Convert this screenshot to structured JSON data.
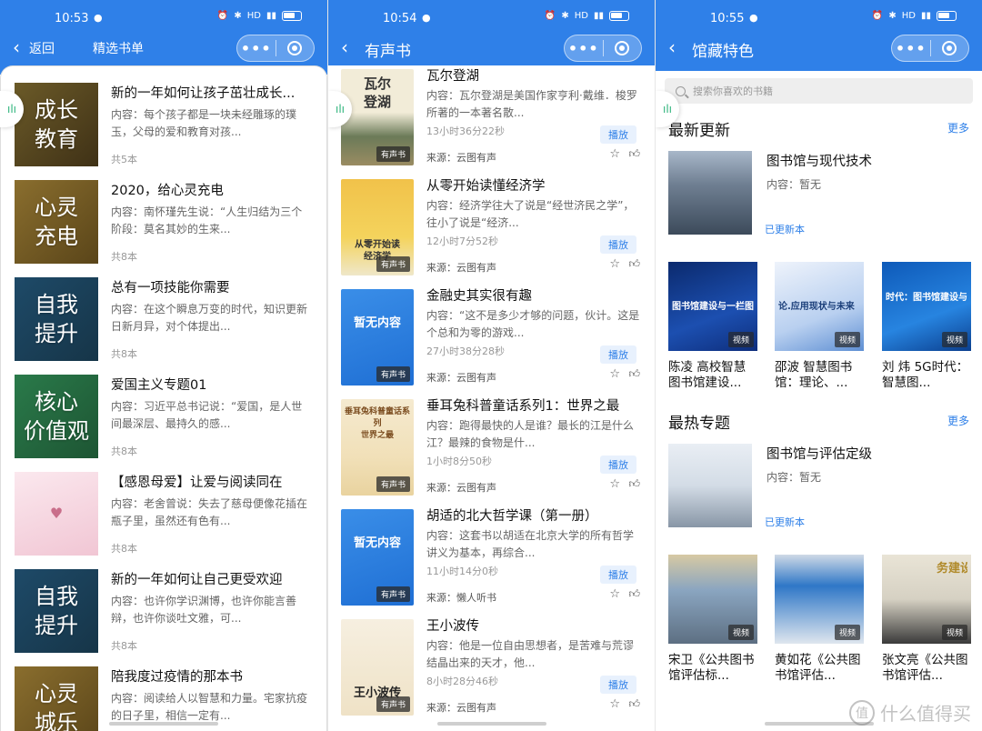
{
  "screen1": {
    "status": {
      "time": "10:53"
    },
    "nav": {
      "back": "返回",
      "title": "精选书单"
    },
    "items": [
      {
        "cover": "成长\n教育",
        "title": "新的一年如何让孩子茁壮成长...",
        "desc": "内容：每个孩子都是一块未经雕琢的璞玉，父母的爱和教育对孩...",
        "count": "共5本"
      },
      {
        "cover": "心灵\n充电",
        "title": "2020，给心灵充电",
        "desc": "内容：南怀瑾先生说：“人生归结为三个阶段：莫名其妙的生来...",
        "count": "共8本"
      },
      {
        "cover": "自我\n提升",
        "title": "总有一项技能你需要",
        "desc": "内容：在这个瞬息万变的时代，知识更新日新月异，对个体提出...",
        "count": "共8本"
      },
      {
        "cover": "核心\n价值观",
        "title": "爱国主义专题01",
        "desc": "内容：习近平总书记说：“爱国，是人世间最深层、最持久的感...",
        "count": "共8本"
      },
      {
        "cover": "",
        "title": "【感恩母爱】让爱与阅读同在",
        "desc": "内容：老舍曾说：失去了慈母便像花插在瓶子里，虽然还有色有...",
        "count": "共8本"
      },
      {
        "cover": "自我\n提升",
        "title": "新的一年如何让自己更受欢迎",
        "desc": "内容：也许你学识渊博，也许你能言善辩，也许你谈吐文雅，可...",
        "count": "共8本"
      },
      {
        "cover": "心灵\n城乐",
        "title": "陪我度过疫情的那本书",
        "desc": "内容：阅读给人以智慧和力量。宅家抗疫的日子里，相信一定有...",
        "count": ""
      }
    ]
  },
  "screen2": {
    "status": {
      "time": "10:54"
    },
    "nav": {
      "title": "有声书"
    },
    "play_label": "播放",
    "badge": "有声书",
    "items": [
      {
        "cover_text": "瓦尔\n登湖",
        "title": "瓦尔登湖",
        "desc": "内容：瓦尔登湖是美国作家亨利·戴维．梭罗所著的一本著名散...",
        "dur": "13小时36分22秒",
        "source": "来源：云图有声"
      },
      {
        "cover_text": "从零开始读\n经济学",
        "title": "从零开始读懂经济学",
        "desc": "内容：经济学往大了说是“经世济民之学”，往小了说是“经济...",
        "dur": "12小时7分52秒",
        "source": "来源：云图有声"
      },
      {
        "cover_text": "暂无内容",
        "title": "金融史其实很有趣",
        "desc": "内容：“这不是多少才够的问题，伙计。这是个总和为零的游戏...",
        "dur": "27小时38分28秒",
        "source": "来源：云图有声"
      },
      {
        "cover_text": "垂耳兔科普童话系列\n世界之最",
        "title": "垂耳兔科普童话系列1：世界之最",
        "desc": "内容：跑得最快的人是谁？最长的江是什么江？最辣的食物是什...",
        "dur": "1小时8分50秒",
        "source": "来源：云图有声"
      },
      {
        "cover_text": "暂无内容",
        "title": "胡适的北大哲学课（第一册）",
        "desc": "内容：这套书以胡适在北京大学的所有哲学讲义为基本，再综合...",
        "dur": "11小时14分0秒",
        "source": "来源：懒人听书"
      },
      {
        "cover_text": "王小波传",
        "title": "王小波传",
        "desc": "内容：他是一位自由思想者，是苦难与荒谬结晶出来的天才，他...",
        "dur": "8小时28分46秒",
        "source": "来源：云图有声"
      }
    ]
  },
  "screen3": {
    "status": {
      "time": "10:55"
    },
    "nav": {
      "title": "馆藏特色"
    },
    "search_placeholder": "搜索你喜欢的书籍",
    "sections": [
      {
        "title": "最新更新",
        "more": "更多",
        "featured": {
          "title": "图书馆与现代技术",
          "desc": "内容：暂无",
          "status": "已更新本"
        },
        "videos": [
          {
            "caption": "陈凌 高校智慧图书馆建设...",
            "thumb_text": "图书馆建设与一栏图书",
            "label": "视频"
          },
          {
            "caption": "邵波 智慧图书馆：理论、...",
            "thumb_text": "论.应用现状与未来",
            "label": "视频"
          },
          {
            "caption": "刘 炜 5G时代：智慧图...",
            "thumb_text": "时代：图书馆建设与服务",
            "label": "视频"
          }
        ]
      },
      {
        "title": "最热专题",
        "more": "更多",
        "featured": {
          "title": "图书馆与评估定级",
          "desc": "内容：暂无",
          "status": "已更新本"
        },
        "videos": [
          {
            "caption": "宋卫《公共图书馆评估标...",
            "thumb_text": "",
            "label": "视频"
          },
          {
            "caption": "黄如花《公共图书馆评估...",
            "thumb_text": "",
            "label": "视频"
          },
          {
            "caption": "张文亮《公共图书馆评估...",
            "thumb_text": "务建设",
            "label": "视频"
          }
        ]
      }
    ]
  },
  "watermark": "什么值得买",
  "colors": {
    "brand_blue": "#2f80e8",
    "link_blue": "#2f80e8"
  }
}
